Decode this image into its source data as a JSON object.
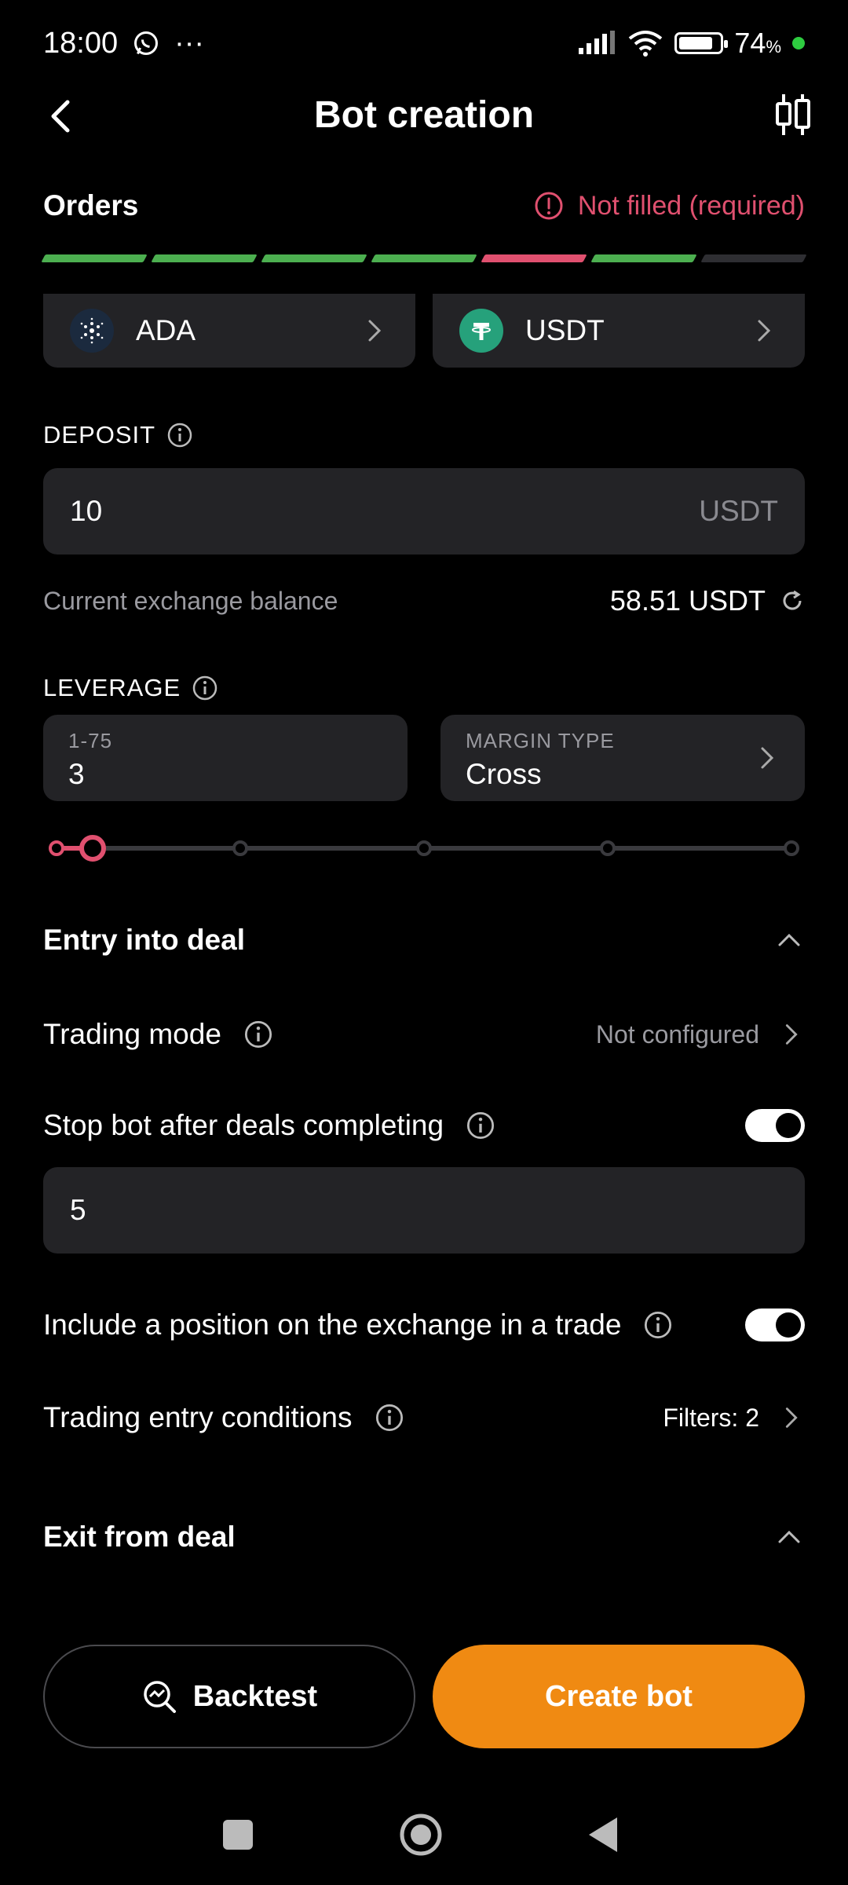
{
  "status": {
    "time": "18:00",
    "dots": "···",
    "battery": "74",
    "battery_unit": "%"
  },
  "header": {
    "title": "Bot creation"
  },
  "orders": {
    "title": "Orders",
    "status": "Not filled (required)",
    "progress": [
      "done",
      "done",
      "done",
      "done",
      "error",
      "done",
      "empty"
    ]
  },
  "pair": {
    "base": "ADA",
    "quote": "USDT"
  },
  "deposit": {
    "label": "DEPOSIT",
    "value": "10",
    "unit": "USDT"
  },
  "balance": {
    "label": "Current exchange balance",
    "value": "58.51 USDT"
  },
  "leverage": {
    "label": "LEVERAGE",
    "range": "1-75",
    "value": "3",
    "slider_fraction": 0.027
  },
  "margin": {
    "caption": "MARGIN TYPE",
    "value": "Cross"
  },
  "entry": {
    "title": "Entry into deal",
    "trading_mode_label": "Trading mode",
    "trading_mode_value": "Not configured",
    "stop_bot_label": "Stop bot after deals completing",
    "stop_bot_enabled": true,
    "stop_bot_value": "5",
    "include_position_label": "Include a position on the exchange in a trade",
    "include_position_enabled": true,
    "conditions_label": "Trading entry conditions",
    "conditions_value": "Filters: 2"
  },
  "exit": {
    "title": "Exit from deal"
  },
  "actions": {
    "backtest": "Backtest",
    "create": "Create bot"
  },
  "colors": {
    "accent": "#f08a12",
    "error": "#e0506f",
    "success": "#4caf50",
    "card": "#232326"
  }
}
